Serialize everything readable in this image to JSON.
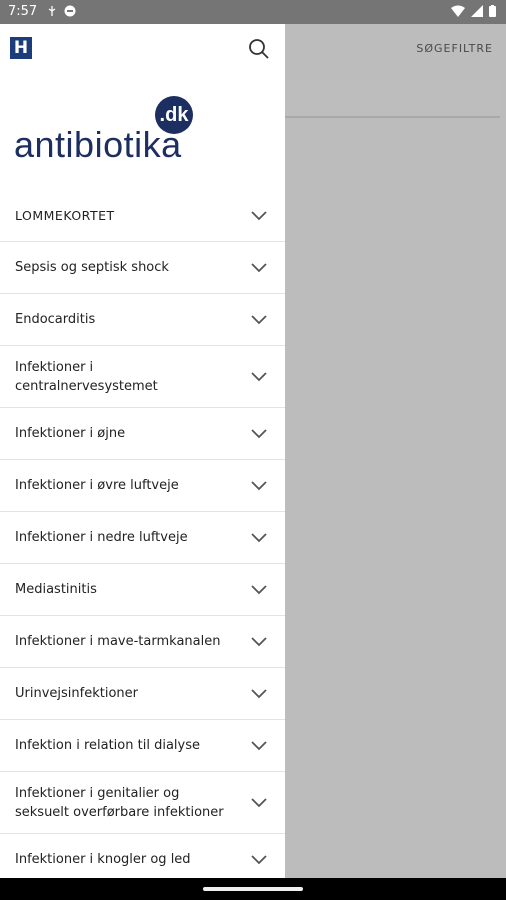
{
  "status_bar": {
    "time": "7:57"
  },
  "background": {
    "filter_label": "SØGEFILTRE"
  },
  "drawer": {
    "h_logo": "H",
    "brand": {
      "dot": ".dk",
      "name": "antibiotika"
    },
    "menu": [
      {
        "label": "LOMMEKORTET"
      },
      {
        "label": "Sepsis og septisk shock"
      },
      {
        "label": "Endocarditis"
      },
      {
        "label": "Infektioner i centralnervesystemet"
      },
      {
        "label": "Infektioner i øjne"
      },
      {
        "label": "Infektioner i øvre luftveje"
      },
      {
        "label": "Infektioner i nedre luftveje"
      },
      {
        "label": "Mediastinitis"
      },
      {
        "label": "Infektioner i mave-tarmkanalen"
      },
      {
        "label": "Urinvejsinfektioner"
      },
      {
        "label": "Infektion i relation til dialyse"
      },
      {
        "label": "Infektioner i genitalier og seksuelt overførbare infektioner"
      },
      {
        "label": "Infektioner i knogler og led"
      }
    ]
  },
  "colors": {
    "brand": "#1c2f60",
    "h_logo": "#1c3d7a",
    "scrim": "#bdbdbd"
  }
}
